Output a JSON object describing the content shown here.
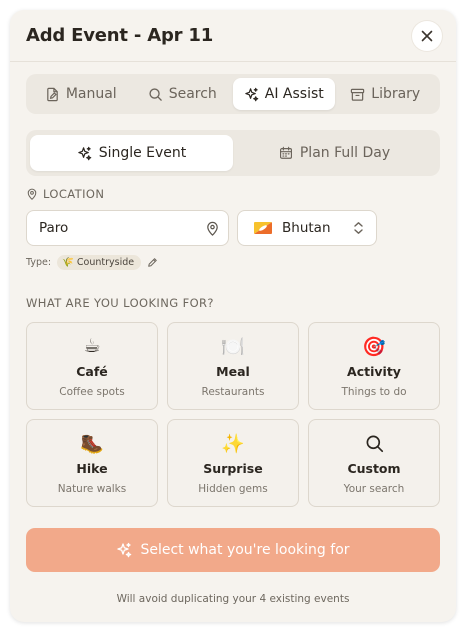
{
  "header": {
    "title": "Add Event - Apr 11"
  },
  "mode_tabs": [
    {
      "label": "Manual",
      "icon": "pen-document-icon",
      "active": false
    },
    {
      "label": "Search",
      "icon": "search-icon",
      "active": false
    },
    {
      "label": "AI Assist",
      "icon": "sparkles-icon",
      "active": true
    },
    {
      "label": "Library",
      "icon": "archive-icon",
      "active": false
    }
  ],
  "scope_tabs": [
    {
      "label": "Single Event",
      "icon": "sparkles-icon",
      "active": true
    },
    {
      "label": "Plan Full Day",
      "icon": "calendar-icon",
      "active": false
    }
  ],
  "location": {
    "label": "LOCATION",
    "city": "Paro",
    "country": "Bhutan",
    "type_label": "Type:",
    "type_value": "Countryside",
    "type_emoji": "🌾"
  },
  "looking_for": {
    "label": "WHAT ARE YOU LOOKING FOR?",
    "options": [
      {
        "title": "Café",
        "subtitle": "Coffee spots",
        "emoji": "☕"
      },
      {
        "title": "Meal",
        "subtitle": "Restaurants",
        "emoji": "🍽️"
      },
      {
        "title": "Activity",
        "subtitle": "Things to do",
        "emoji": "🎯"
      },
      {
        "title": "Hike",
        "subtitle": "Nature walks",
        "emoji": "🥾"
      },
      {
        "title": "Surprise",
        "subtitle": "Hidden gems",
        "emoji": "✨"
      },
      {
        "title": "Custom",
        "subtitle": "Your search",
        "emoji": ""
      }
    ]
  },
  "cta": {
    "label": "Select what you're looking for"
  },
  "footnote": "Will avoid duplicating your 4 existing events",
  "colors": {
    "cta": "#f2a98a",
    "background": "#f6f3ee",
    "flag_yellow": "#f7c22d",
    "flag_orange": "#ec6d2a"
  }
}
